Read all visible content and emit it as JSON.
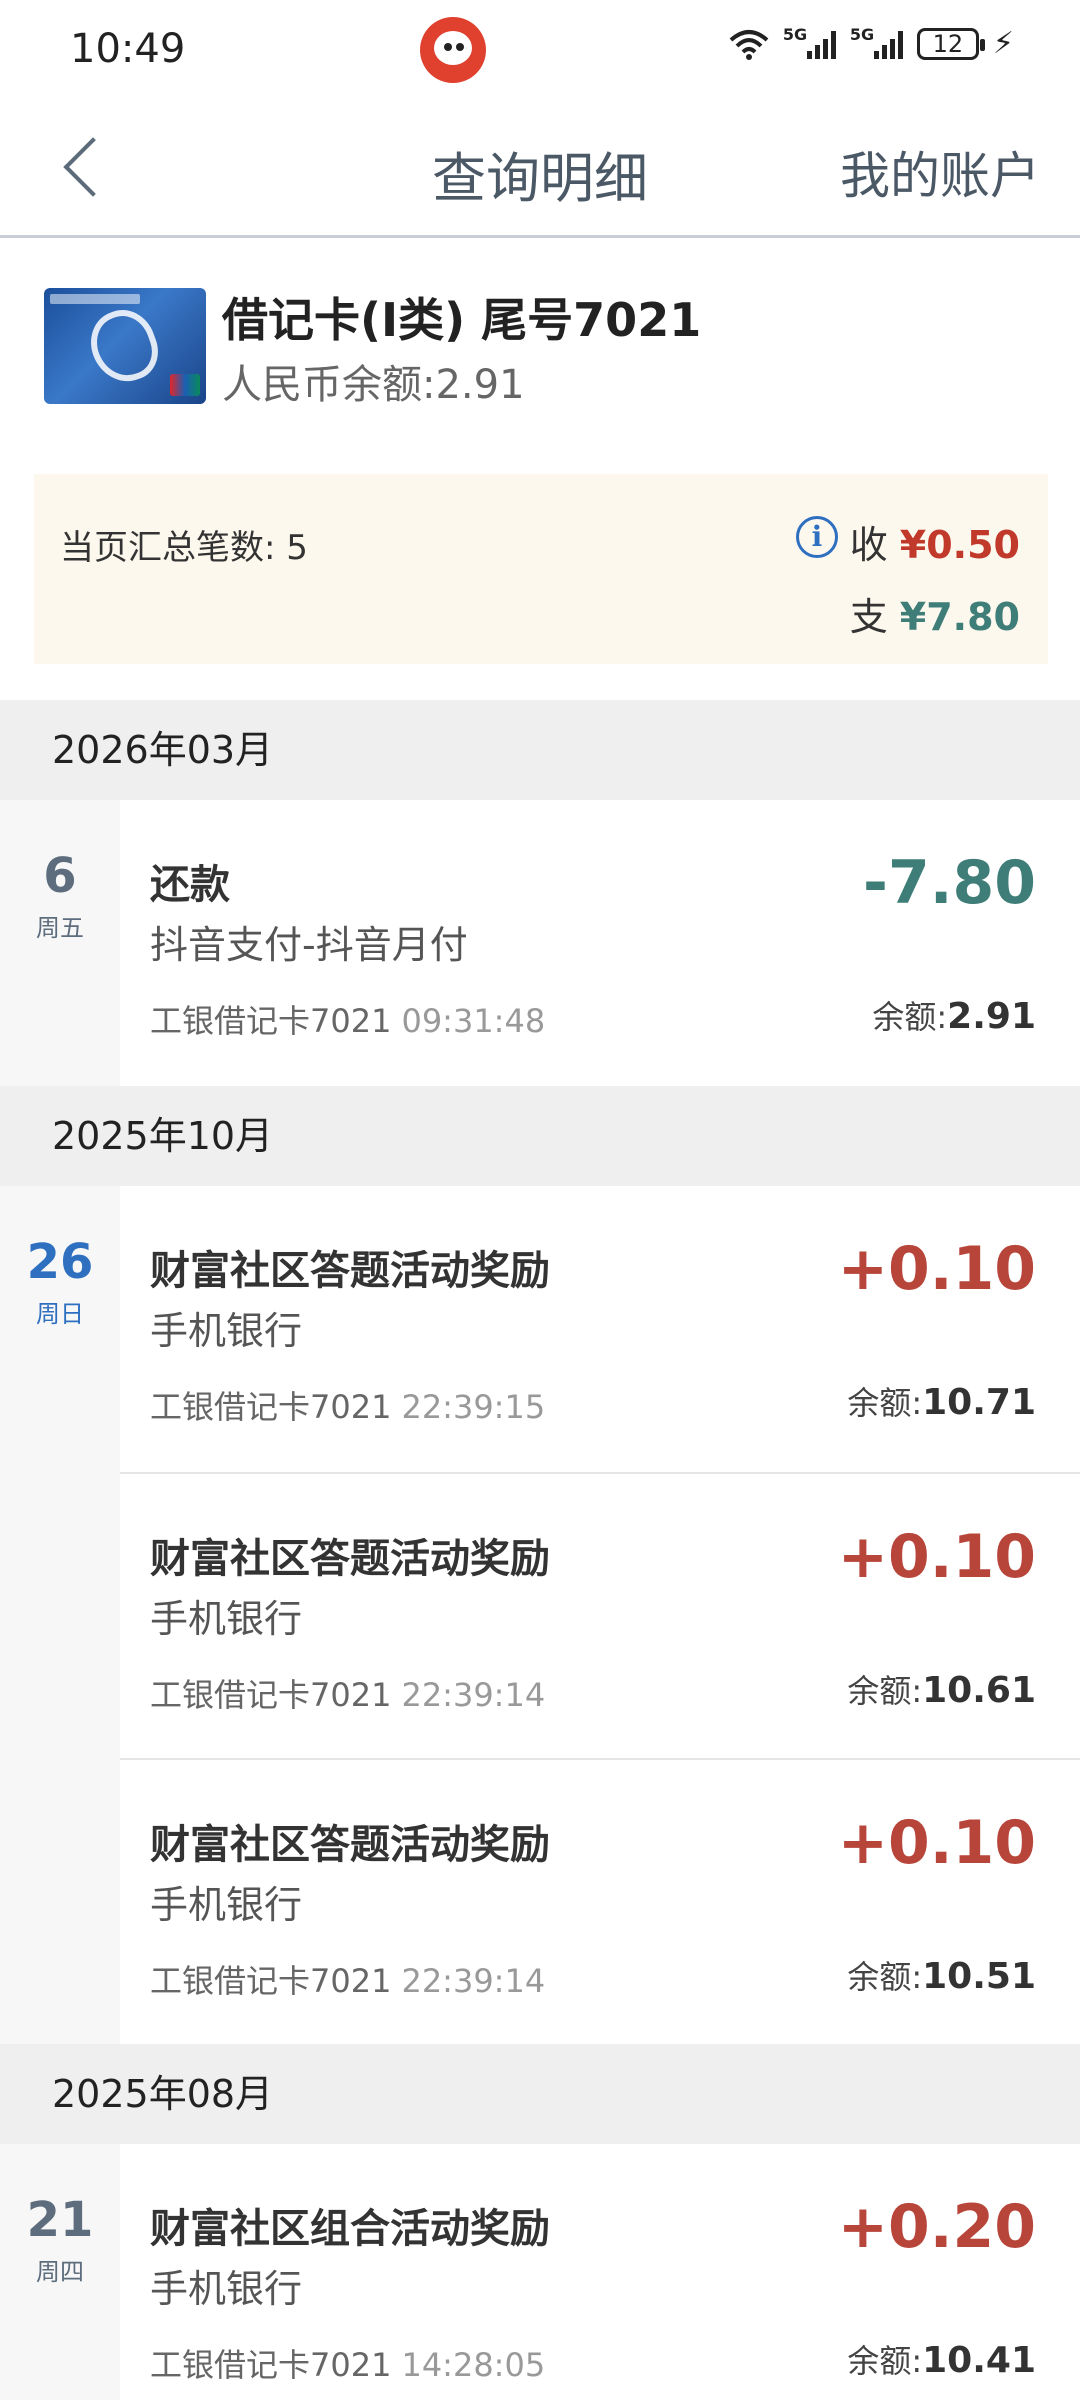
{
  "status_bar": {
    "time": "10:49",
    "network_1": "5G",
    "network_2": "5G",
    "battery": "12"
  },
  "header": {
    "title": "查询明细",
    "right_link": "我的账户"
  },
  "card": {
    "name": "借记卡(I类) 尾号7021",
    "balance": "人民币余额:2.91"
  },
  "summary": {
    "count_text": "当页汇总笔数: 5",
    "income_label": "收",
    "income_amount": "¥0.50",
    "expense_label": "支",
    "expense_amount": "¥7.80"
  },
  "groups": [
    {
      "month": "2026年03月",
      "day": "6",
      "weekday": "周五",
      "items": [
        {
          "title": "还款",
          "subtitle": "抖音支付-抖音月付",
          "card": "工银借记卡7021",
          "time": "09:31:48",
          "amount": "-7.80",
          "balance_label": "余额:",
          "balance": "2.91"
        }
      ]
    },
    {
      "month": "2025年10月",
      "day": "26",
      "weekday": "周日",
      "items": [
        {
          "title": "财富社区答题活动奖励",
          "subtitle": "手机银行",
          "card": "工银借记卡7021",
          "time": "22:39:15",
          "amount": "+0.10",
          "balance_label": "余额:",
          "balance": "10.71"
        },
        {
          "title": "财富社区答题活动奖励",
          "subtitle": "手机银行",
          "card": "工银借记卡7021",
          "time": "22:39:14",
          "amount": "+0.10",
          "balance_label": "余额:",
          "balance": "10.61"
        },
        {
          "title": "财富社区答题活动奖励",
          "subtitle": "手机银行",
          "card": "工银借记卡7021",
          "time": "22:39:14",
          "amount": "+0.10",
          "balance_label": "余额:",
          "balance": "10.51"
        }
      ]
    },
    {
      "month": "2025年08月",
      "day": "21",
      "weekday": "周四",
      "items": [
        {
          "title": "财富社区组合活动奖励",
          "subtitle": "手机银行",
          "card": "工银借记卡7021",
          "time": "14:28:05",
          "amount": "+0.20",
          "balance_label": "余额:",
          "balance": "10.41"
        }
      ]
    }
  ],
  "colors": {
    "expense": "#3e7d78",
    "income": "#b8453a",
    "accent_blue": "#2f6fc0",
    "summary_bg": "#fdf8ee"
  }
}
